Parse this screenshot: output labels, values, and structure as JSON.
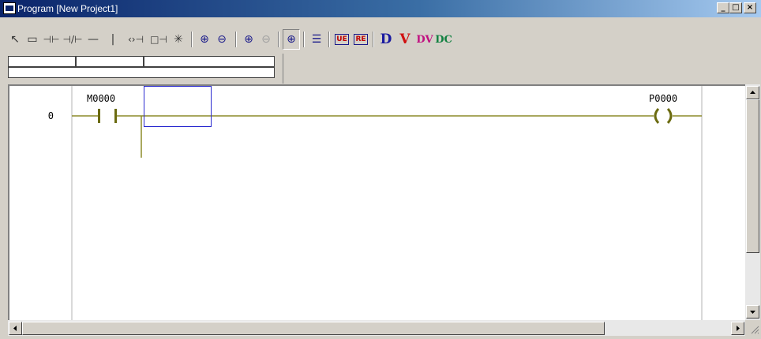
{
  "window": {
    "title": "Program [New Project1]",
    "buttons": {
      "minimize": "_",
      "maximize": "□",
      "close": "×"
    }
  },
  "toolbar": {
    "tools": [
      {
        "name": "select-arrow-tool",
        "glyph": "↖"
      },
      {
        "name": "rectangle-select-tool",
        "glyph": "▭"
      },
      {
        "name": "normally-open-contact-tool",
        "glyph": "⊣⊢"
      },
      {
        "name": "normally-closed-contact-tool",
        "glyph": "⊣/⊢"
      },
      {
        "name": "horizontal-line-tool",
        "glyph": "—"
      },
      {
        "name": "vertical-line-tool",
        "glyph": "|"
      },
      {
        "name": "output-coil-tool",
        "glyph": "‹›⊣"
      },
      {
        "name": "function-block-tool",
        "glyph": "□⊣"
      },
      {
        "name": "special-tool",
        "glyph": "✳"
      },
      {
        "name": "zoom-in-tool",
        "glyph": "⊕"
      },
      {
        "name": "zoom-out-tool",
        "glyph": "⊖"
      },
      {
        "name": "zoom-in-red-tool",
        "glyph": "⊕"
      },
      {
        "name": "zoom-out-disabled-tool",
        "glyph": "⊖"
      },
      {
        "name": "zoom-fit-tool",
        "glyph": "⊕"
      },
      {
        "name": "align-text-tool",
        "glyph": "☰"
      },
      {
        "name": "ue-tool",
        "glyph": "UE"
      },
      {
        "name": "re-tool",
        "glyph": "RE"
      },
      {
        "name": "d-tool",
        "glyph": "D"
      },
      {
        "name": "v-tool",
        "glyph": "V"
      },
      {
        "name": "dv-tool",
        "glyph": "DV"
      },
      {
        "name": "dc-tool",
        "glyph": "DC"
      }
    ]
  },
  "ladder": {
    "rung_number": "0",
    "contact_label": "M0000",
    "coil_label": "P0000"
  },
  "colors": {
    "rail": "#b3b3b3",
    "wire": "#8c8a28",
    "element": "#6b6b10",
    "cursor": "#2a2ad0"
  }
}
